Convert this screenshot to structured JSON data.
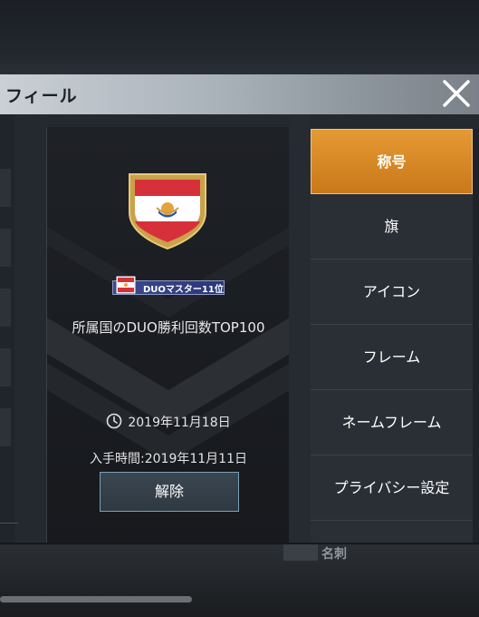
{
  "header": {
    "title": "フィール"
  },
  "card": {
    "badge_text": "DUOマスター11位",
    "description": "所属国のDUO勝利回数TOP100",
    "expire_date": "2019年11月18日",
    "acquired": "入手時間:2019年11月11日",
    "release_label": "解除"
  },
  "tabs": [
    {
      "label": "称号",
      "active": true
    },
    {
      "label": "旗",
      "active": false
    },
    {
      "label": "アイコン",
      "active": false
    },
    {
      "label": "フレーム",
      "active": false
    },
    {
      "label": "ネームフレーム",
      "active": false
    },
    {
      "label": "プライバシー設定",
      "active": false
    }
  ],
  "background": {
    "bottom_label": "名刺"
  },
  "colors": {
    "accent": "#e59a33",
    "flag_red": "#d6313a",
    "badge_blue": "#3c4a8f",
    "emblem_gold": "#c9a24a"
  }
}
